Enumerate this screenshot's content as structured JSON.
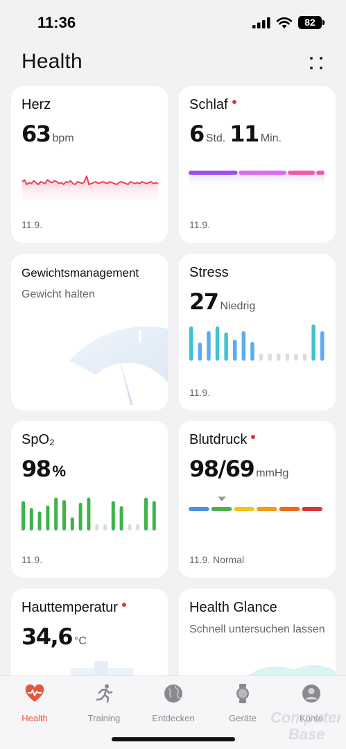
{
  "status_bar": {
    "time": "11:36",
    "battery": "82"
  },
  "header": {
    "title": "Health",
    "more_icon": "grid-dots-icon"
  },
  "cards": {
    "herz": {
      "title": "Herz",
      "value": "63",
      "unit": "bpm",
      "date": "11.9.",
      "color": "#e8405a",
      "trend": [
        58,
        60,
        55,
        57,
        56,
        59,
        57,
        55,
        58,
        57,
        56,
        60,
        58,
        57,
        59,
        58,
        56,
        57,
        55,
        58,
        57,
        59,
        56,
        55,
        58,
        57,
        56,
        58,
        64,
        55,
        56,
        57,
        58,
        56,
        57,
        58,
        57,
        56,
        58,
        57,
        56,
        55,
        57,
        58,
        57,
        56,
        55,
        58,
        57,
        56,
        57,
        56,
        58,
        57,
        56,
        57,
        58,
        56,
        57,
        56
      ]
    },
    "schlaf": {
      "title": "Schlaf",
      "hours": "6",
      "hours_unit": "Std.",
      "minutes": "11",
      "minutes_unit": "Min.",
      "date": "11.9.",
      "segments": [
        {
          "color": "#9b4ff0",
          "share": 0.37
        },
        {
          "color": "#d86cf0",
          "share": 0.36
        },
        {
          "color": "#f05aa6",
          "share": 0.21
        }
      ]
    },
    "gewicht": {
      "title": "Gewichtsmanagement",
      "subtitle": "Gewicht halten"
    },
    "stress": {
      "title": "Stress",
      "value": "27",
      "level": "Niedrig",
      "date": "11.9.",
      "bars": [
        {
          "v": 0.95,
          "c": "#3fc3d2"
        },
        {
          "v": 0.5,
          "c": "#5aabf2"
        },
        {
          "v": 0.82,
          "c": "#5aabf2"
        },
        {
          "v": 0.95,
          "c": "#3fc3d2"
        },
        {
          "v": 0.78,
          "c": "#3fc3d2"
        },
        {
          "v": 0.58,
          "c": "#5aabf2"
        },
        {
          "v": 0.82,
          "c": "#5aabf2"
        },
        {
          "v": 0.52,
          "c": "#5aabf2"
        },
        {
          "v": 0.2,
          "c": "#dcdcdc"
        },
        {
          "v": 0.2,
          "c": "#dcdcdc"
        },
        {
          "v": 0.2,
          "c": "#dcdcdc"
        },
        {
          "v": 0.2,
          "c": "#dcdcdc"
        },
        {
          "v": 0.2,
          "c": "#dcdcdc"
        },
        {
          "v": 0.2,
          "c": "#dcdcdc"
        },
        {
          "v": 1.0,
          "c": "#3fc3d2"
        },
        {
          "v": 0.82,
          "c": "#5aabf2"
        }
      ]
    },
    "spo2": {
      "title": "SpO₂",
      "value": "98",
      "unit": "%",
      "date": "11.9.",
      "color": "#3db34a",
      "bars": [
        0.85,
        0.65,
        0.55,
        0.72,
        0.95,
        0.88,
        0.38,
        0.8,
        0.95,
        0.18,
        0.18,
        0.85,
        0.7,
        0.18,
        0.18,
        0.95,
        0.85
      ]
    },
    "blutdruck": {
      "title": "Blutdruck",
      "value": "98/69",
      "unit": "mmHg",
      "date": "11.9.",
      "status": "Normal",
      "scale_colors": [
        "#4a90e2",
        "#4ab34a",
        "#f0c419",
        "#f59b16",
        "#f06a16",
        "#d9363e"
      ],
      "marker_index": 1
    },
    "haut": {
      "title": "Hauttemperatur",
      "value": "34,6",
      "unit": "°C"
    },
    "glance": {
      "title": "Health Glance",
      "subtitle": "Schnell untersuchen lassen"
    }
  },
  "nav": [
    {
      "label": "Health",
      "icon": "heart-pulse-icon",
      "active": true
    },
    {
      "label": "Training",
      "icon": "running-person-icon",
      "active": false
    },
    {
      "label": "Entdecken",
      "icon": "globe-icon",
      "active": false
    },
    {
      "label": "Geräte",
      "icon": "watch-icon",
      "active": false
    },
    {
      "label": "Konto",
      "icon": "person-icon",
      "active": false
    }
  ],
  "watermark": {
    "line1": "Computer",
    "line2": "Base"
  },
  "colors": {
    "accent": "#e8563a",
    "background": "#f2f2f5",
    "card": "#ffffff"
  }
}
